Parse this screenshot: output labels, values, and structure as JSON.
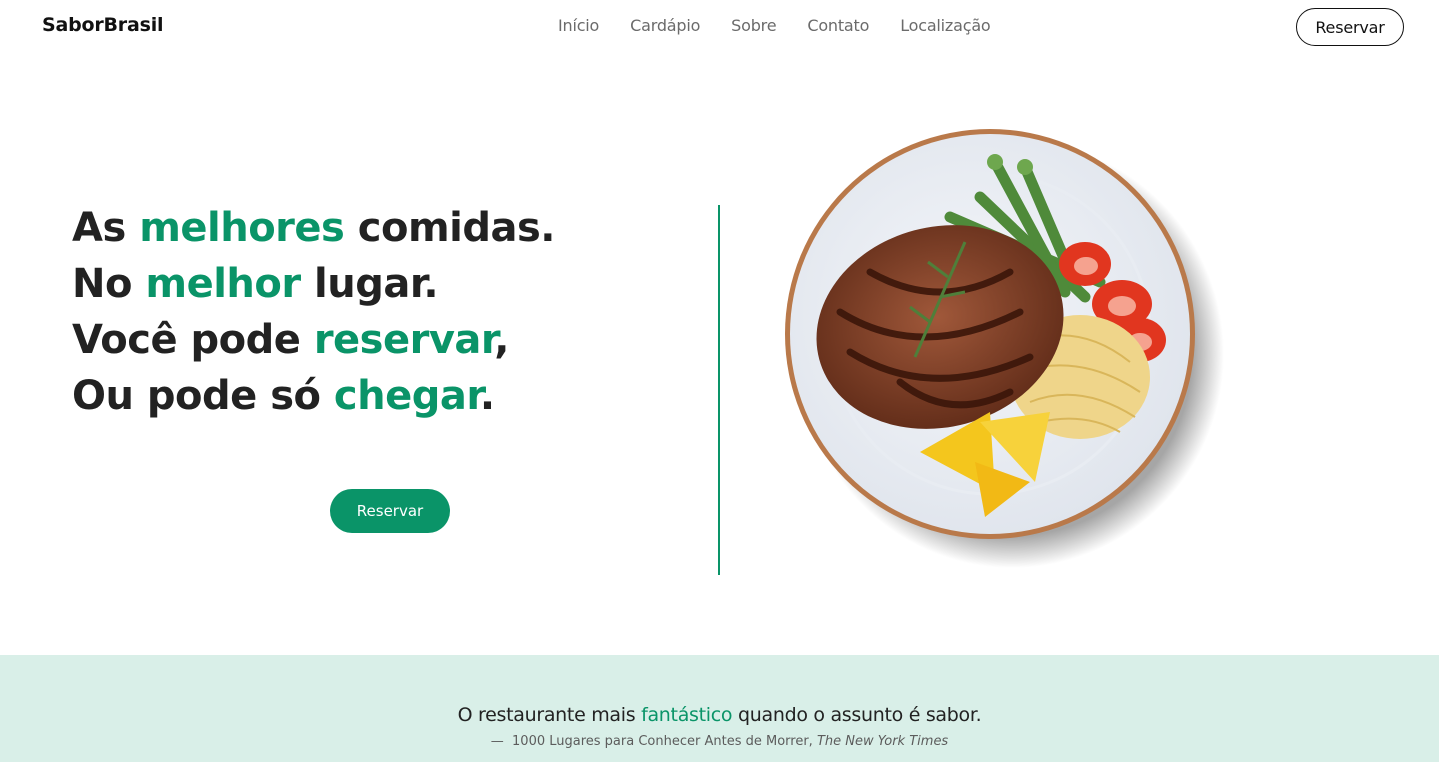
{
  "header": {
    "brand": "SaborBrasil",
    "nav": [
      "Início",
      "Cardápio",
      "Sobre",
      "Contato",
      "Localização"
    ],
    "reserve_label": "Reservar"
  },
  "hero": {
    "line1": {
      "a": "As ",
      "b": "melhores",
      "c": " comidas."
    },
    "line2": {
      "a": "No ",
      "b": "melhor",
      "c": " lugar."
    },
    "line3": {
      "a": "Você pode ",
      "b": "reservar",
      "c": ","
    },
    "line4": {
      "a": "Ou pode só ",
      "b": "chegar",
      "c": "."
    },
    "cta_label": "Reservar",
    "image_icon": "steak-plate-image"
  },
  "quote": {
    "text_a": "O restaurante mais ",
    "text_b": "fantástico",
    "text_c": " quando o assunto é sabor.",
    "dash": "—",
    "source": "1000 Lugares para Conhecer Antes de Morrer,",
    "publication": "The New York Times"
  },
  "colors": {
    "accent": "#0a9468",
    "band": "#d9efe8",
    "text": "#222222"
  }
}
